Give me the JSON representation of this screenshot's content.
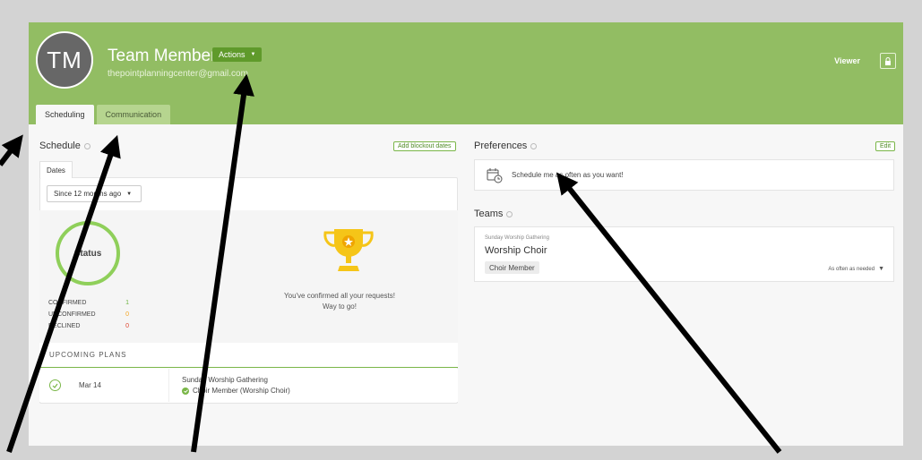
{
  "header": {
    "initials": "TM",
    "name": "Team Member",
    "actions_label": "Actions",
    "email": "thepointplanningcenter@gmail.com",
    "viewer_label": "Viewer",
    "tabs": [
      {
        "label": "Scheduling",
        "active": true
      },
      {
        "label": "Communication",
        "active": false
      }
    ]
  },
  "schedule": {
    "title": "Schedule",
    "add_blockout_label": "Add blockout dates",
    "dates_tab": "Dates",
    "since_value": "Since 12 months ago",
    "status_label": "Status",
    "stats": [
      {
        "label": "CONFIRMED",
        "value": "1",
        "color": "#6db33f"
      },
      {
        "label": "UNCONFIRMED",
        "value": "0",
        "color": "#f5a623"
      },
      {
        "label": "DECLINED",
        "value": "0",
        "color": "#e0442f"
      }
    ],
    "confirm_line1": "You've confirmed all your requests!",
    "confirm_line2": "Way to go!",
    "upcoming_title": "UPCOMING PLANS",
    "plans": [
      {
        "date": "Mar 14",
        "service": "Sunday Worship Gathering",
        "role": "Choir Member (Worship Choir)"
      }
    ]
  },
  "preferences": {
    "title": "Preferences",
    "edit_label": "Edit",
    "text": "Schedule me as often as you want!"
  },
  "teams": {
    "title": "Teams",
    "items": [
      {
        "service_type": "Sunday Worship Gathering",
        "name": "Worship Choir",
        "role": "Choir Member",
        "frequency": "As often as needed"
      }
    ]
  },
  "colors": {
    "header_green": "#92bd63",
    "accent_green": "#7ab648",
    "avatar_gray": "#676767"
  }
}
